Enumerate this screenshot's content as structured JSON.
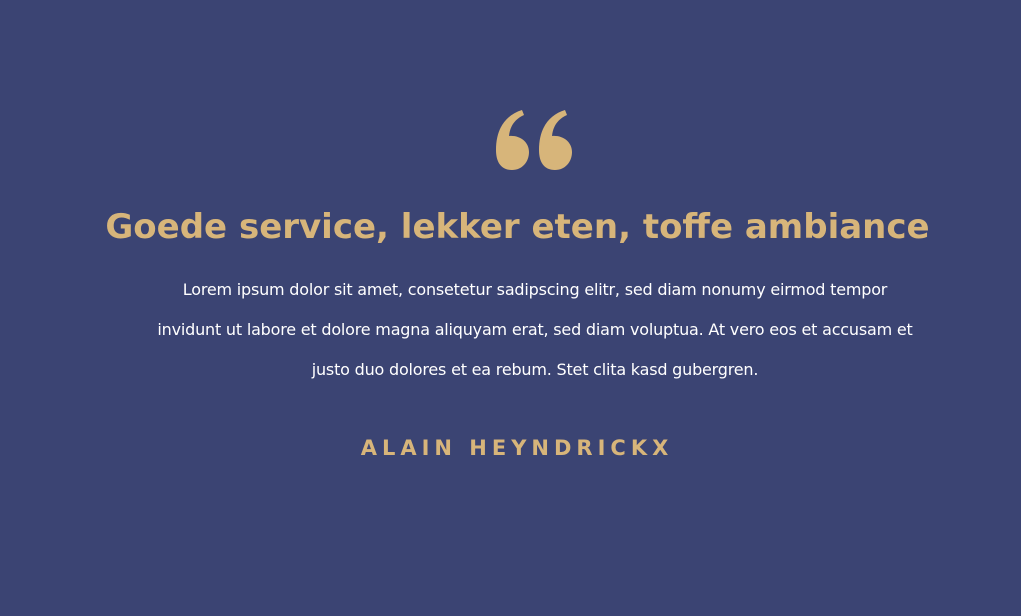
{
  "colors": {
    "background": "#3b4473",
    "accent": "#d7b57a",
    "body_text": "#ffffff"
  },
  "testimonial": {
    "icon": "quote-icon",
    "headline": "Goede service, lekker eten, toffe ambiance",
    "body": "Lorem ipsum dolor sit amet, consetetur sadipscing elitr, sed diam nonumy eirmod tempor invidunt ut labore et dolore magna aliquyam erat, sed diam voluptua. At vero eos et accusam et justo duo dolores et ea rebum. Stet clita kasd gubergren.",
    "author": "ALAIN HEYNDRICKX"
  }
}
